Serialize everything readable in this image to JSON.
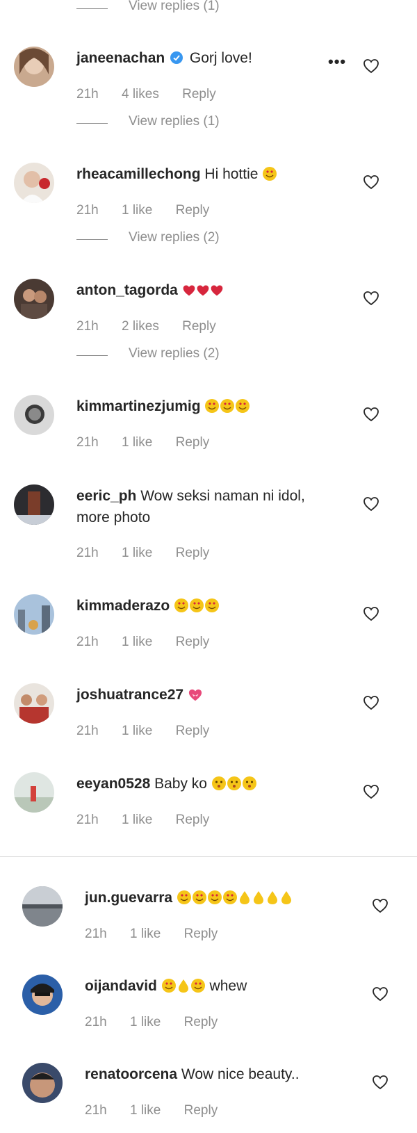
{
  "top_view_replies": "View replies (1)",
  "comments": [
    {
      "username": "janeenachan",
      "verified": true,
      "text": "Gorj love!",
      "emojis": [],
      "time": "21h",
      "likes": "4 likes",
      "reply": "Reply",
      "view_replies": "View replies (1)",
      "has_more": true
    },
    {
      "username": "rheacamillechong",
      "verified": false,
      "text": "Hi hottie",
      "emojis": [
        "smiling-face-with-heart-eyes"
      ],
      "time": "21h",
      "likes": "1 like",
      "reply": "Reply",
      "view_replies": "View replies (2)"
    },
    {
      "username": "anton_tagorda",
      "verified": false,
      "text": "",
      "emojis": [
        "red-heart",
        "red-heart",
        "red-heart"
      ],
      "time": "21h",
      "likes": "2 likes",
      "reply": "Reply",
      "view_replies": "View replies (2)"
    },
    {
      "username": "kimmartinezjumig",
      "verified": false,
      "text": "",
      "emojis": [
        "smiling-face-with-heart-eyes",
        "smiling-face-with-heart-eyes",
        "smiling-face-with-heart-eyes"
      ],
      "time": "21h",
      "likes": "1 like",
      "reply": "Reply"
    },
    {
      "username": "eeric_ph",
      "verified": false,
      "text": "Wow seksi naman ni idol, more photo",
      "emojis": [],
      "time": "21h",
      "likes": "1 like",
      "reply": "Reply"
    },
    {
      "username": "kimmaderazo",
      "verified": false,
      "text": "",
      "emojis": [
        "smiling-face-with-heart-eyes",
        "smiling-face-with-heart-eyes",
        "smiling-face-with-heart-eyes"
      ],
      "time": "21h",
      "likes": "1 like",
      "reply": "Reply"
    },
    {
      "username": "joshuatrance27",
      "verified": false,
      "text": "",
      "emojis": [
        "heart-with-ribbon"
      ],
      "time": "21h",
      "likes": "1 like",
      "reply": "Reply"
    },
    {
      "username": "eeyan0528",
      "verified": false,
      "text": "Baby ko",
      "emojis": [
        "kissing-face",
        "kissing-face",
        "kissing-face"
      ],
      "time": "21h",
      "likes": "1 like",
      "reply": "Reply"
    },
    {
      "username": "jun.guevarra",
      "verified": false,
      "text": "",
      "emojis": [
        "smiling-face-with-heart-eyes",
        "smiling-face-with-heart-eyes",
        "smiling-face-with-heart-eyes",
        "smiling-face-with-heart-eyes",
        "water-droplet",
        "water-droplet",
        "water-droplet",
        "water-droplet"
      ],
      "time": "21h",
      "likes": "1 like",
      "reply": "Reply"
    },
    {
      "username": "oijandavid",
      "verified": false,
      "text": "whew",
      "emojis_before_text": [
        "smiling-face-with-heart-eyes",
        "water-droplet",
        "smiling-face-with-heart-eyes"
      ],
      "time": "21h",
      "likes": "1 like",
      "reply": "Reply"
    },
    {
      "username": "renatoorcena",
      "verified": false,
      "text": "Wow nice beauty..",
      "emojis": [],
      "time": "21h",
      "likes": "1 like",
      "reply": "Reply"
    }
  ],
  "colors": {
    "text": "#262626",
    "secondary": "#8e8e8e",
    "verified": "#3897f0",
    "divider": "#dbdbdb",
    "emoji": "#f5c518",
    "heart": "#d7263d"
  },
  "icons": {
    "like": "heart-outline-icon",
    "more": "more-options-icon",
    "verified": "verified-badge-icon"
  }
}
